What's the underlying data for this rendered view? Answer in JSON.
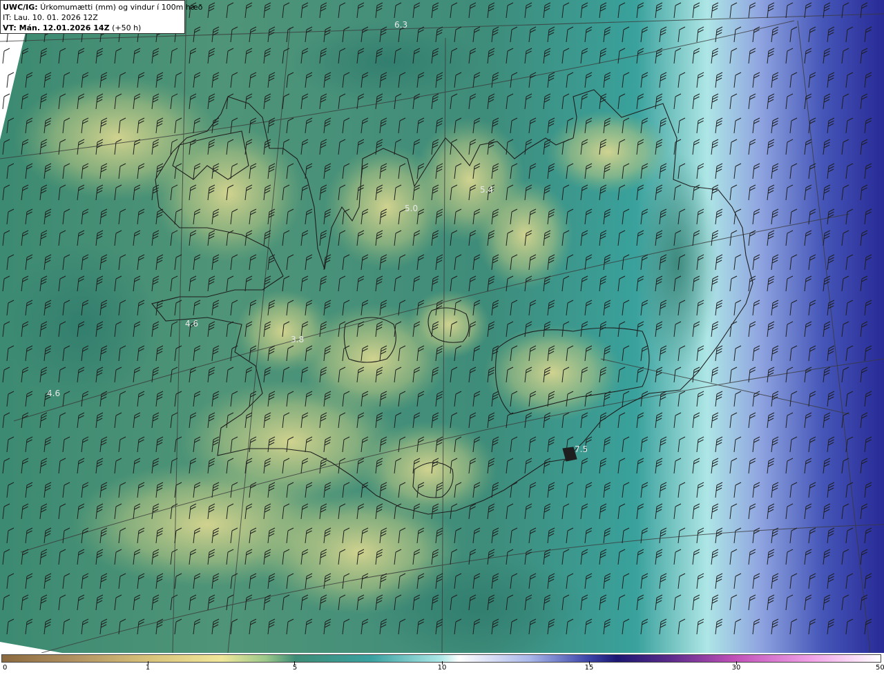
{
  "header": {
    "product": "UWC/IG:",
    "title": "Úrkomumætti (mm) og vindur í 100m hæð",
    "init_time": "IT: Lau. 10. 01. 2026 12Z",
    "valid_prefix": "VT: Mán. 12.01.2026 14Z",
    "valid_suffix": "(+50 h)"
  },
  "map": {
    "region": "Iceland",
    "field": "precipitable water",
    "wind_symbol": "wind barbs",
    "colors": {
      "land_outline": "#1e1e1e",
      "lat_lon_lines": "#3a3a3a",
      "value_label": "#e8e8e8"
    },
    "value_labels": [
      "6.3",
      "5.4",
      "5.0",
      "4.6",
      "3.8",
      "4.6",
      "7.5"
    ]
  },
  "colorbar": {
    "ticks": [
      "0",
      "1",
      "5",
      "10",
      "15",
      "30",
      "50"
    ]
  }
}
